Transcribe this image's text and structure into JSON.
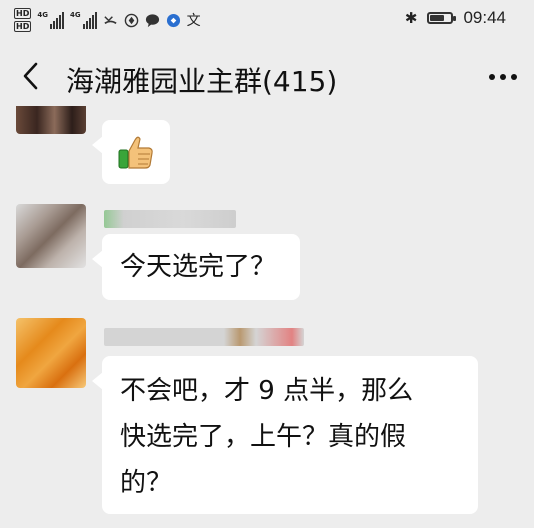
{
  "status_bar": {
    "sim1_label": "HD",
    "sim2_label": "HD",
    "net1_label": "4G",
    "net2_label": "4G",
    "icons": [
      "missed-call-icon",
      "browser-icon",
      "chat-bubble-icon",
      "app-icon",
      "translate-icon",
      "bluetooth-icon",
      "battery-icon"
    ],
    "translate_glyph": "文",
    "bluetooth_glyph": "✱",
    "battery_level": 0.8,
    "time": "09:44"
  },
  "nav": {
    "title": "海潮雅园业主群(415)",
    "back_icon": "chevron-left-icon",
    "more_icon": "more-dots-icon"
  },
  "messages": [
    {
      "type": "sticker",
      "icon": "thumbs-up-icon",
      "sticker": "👍"
    },
    {
      "type": "text",
      "text": "今天选完了？"
    },
    {
      "type": "text",
      "lines": [
        "不会吧，才 9 点半，那么",
        "快选完了，上午？真的假",
        "的？"
      ]
    }
  ],
  "colors": {
    "background": "#ededed",
    "bubble": "#ffffff",
    "text": "#111111"
  }
}
